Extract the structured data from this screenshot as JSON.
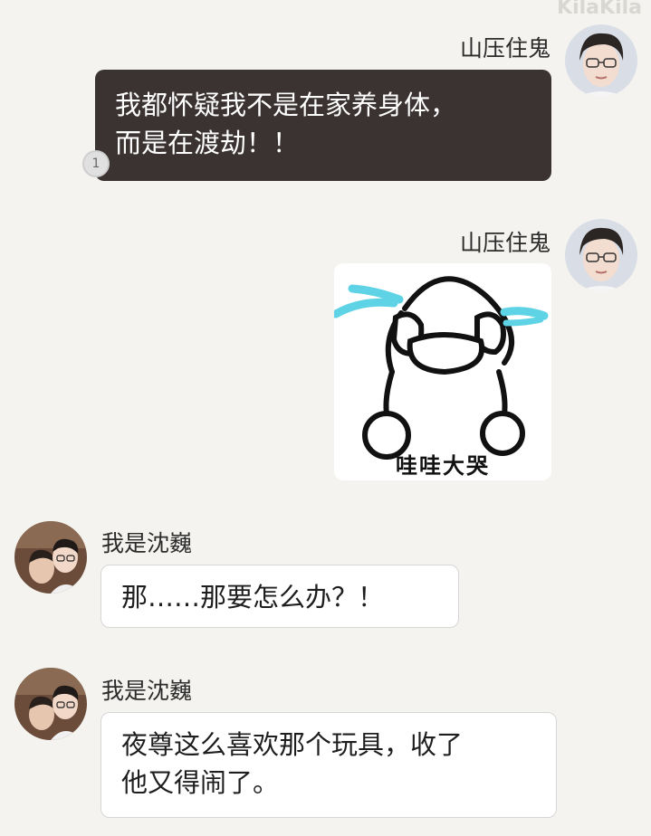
{
  "watermark": "KilaKila",
  "messages": [
    {
      "sender": "山压住鬼",
      "avatar_icon": "man-glasses-avatar-icon",
      "text": "我都怀疑我不是在家养身体，而是在渡劫！！",
      "line1": "我都怀疑我不是在家养身体，",
      "line2": "而是在渡劫！！",
      "badge": "1"
    },
    {
      "sender": "山压住鬼",
      "avatar_icon": "man-glasses-avatar-icon",
      "sticker_icon": "crying-face-sticker-icon",
      "sticker_caption": "哇哇大哭"
    },
    {
      "sender": "我是沈巍",
      "avatar_icon": "two-men-avatar-icon",
      "text": "那……那要怎么办？！"
    },
    {
      "sender": "我是沈巍",
      "avatar_icon": "two-men-avatar-icon",
      "line1": "夜尊这么喜欢那个玩具，收了",
      "line2": "他又得闹了。"
    }
  ],
  "colors": {
    "background": "#f4f3ef",
    "dark_bubble": "#3b3332",
    "light_bubble": "#ffffff",
    "tear_blue": "#5fd3e6"
  }
}
